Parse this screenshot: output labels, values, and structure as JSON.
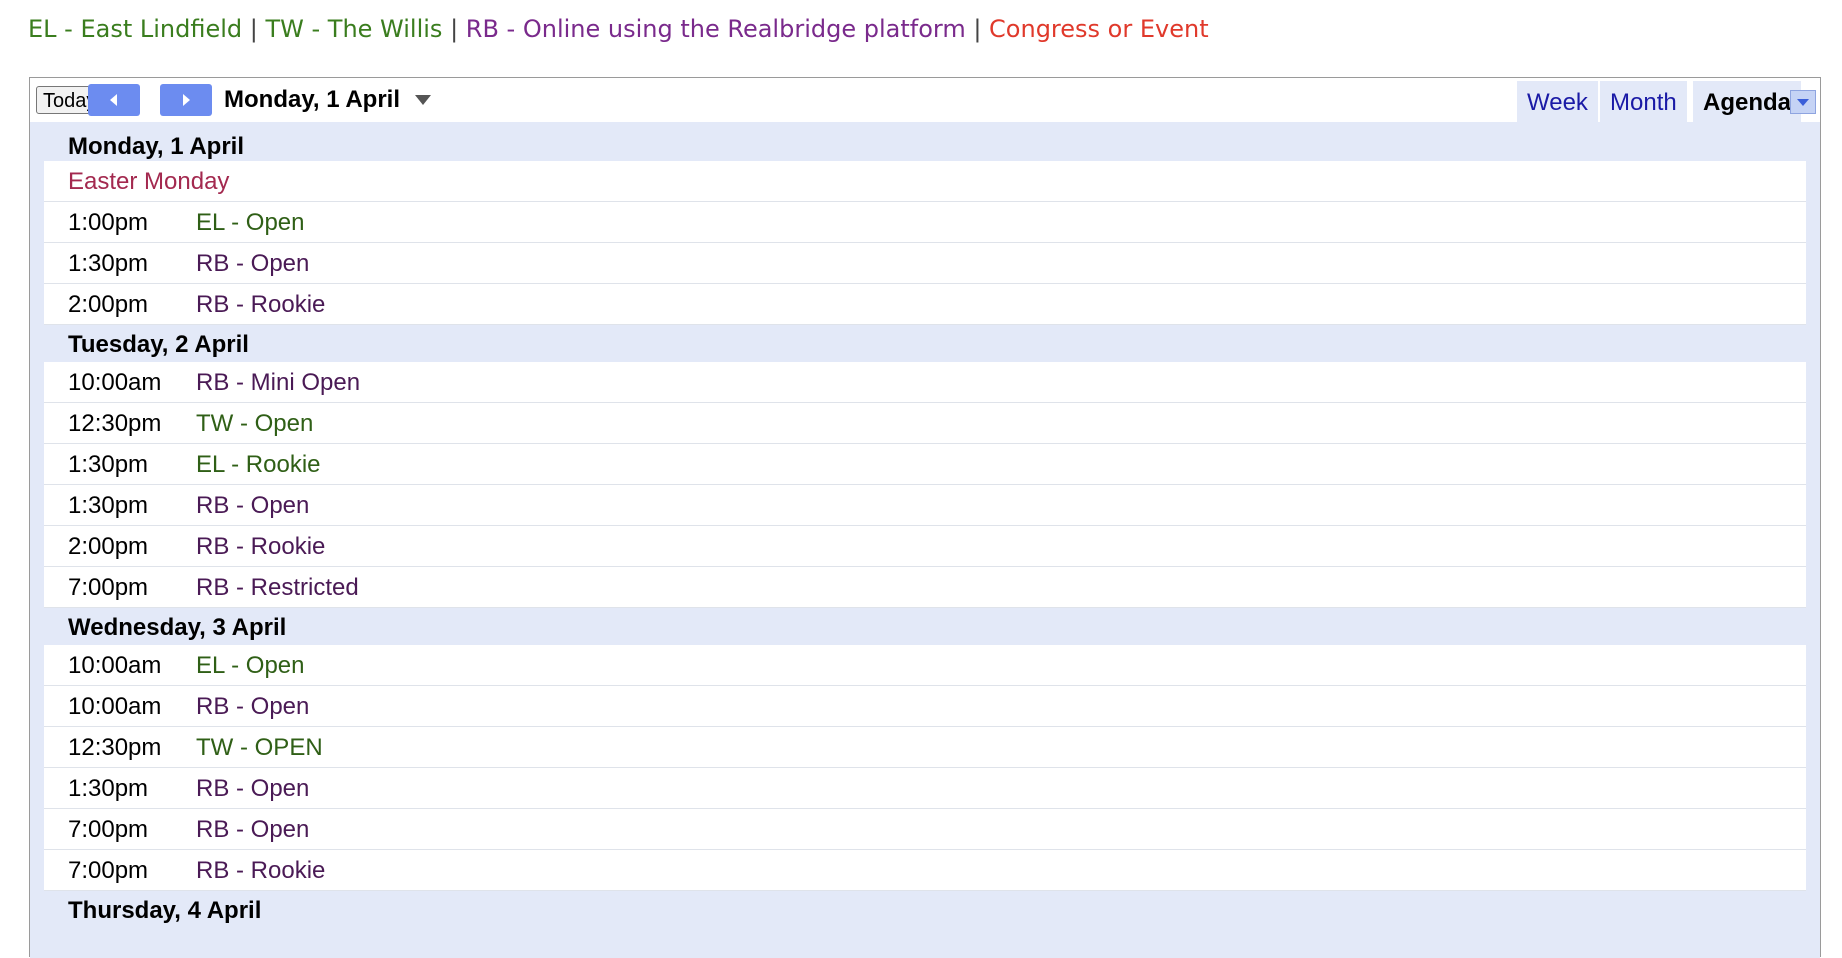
{
  "legend": [
    {
      "text": "EL - East Lindfield",
      "color": "#3a7d1e"
    },
    {
      "text": "TW - The Willis",
      "color": "#3a7d1e"
    },
    {
      "text": "RB - Online using the Realbridge platform",
      "color": "#7a2a8c"
    },
    {
      "text": "Congress or Event",
      "color": "#e0392b"
    }
  ],
  "legend_separator": "|",
  "toolbar": {
    "today_label": "Today",
    "prev_icon": "chevron-left-icon",
    "next_icon": "chevron-right-icon",
    "current_date": "Monday, 1 April",
    "date_dropdown_icon": "caret-down-icon"
  },
  "view_tabs": [
    {
      "label": "Week",
      "active": false
    },
    {
      "label": "Month",
      "active": false
    },
    {
      "label": "Agenda",
      "active": true
    }
  ],
  "colors": {
    "el": "#2f5f16",
    "tw": "#2f5f16",
    "rb": "#4a1a55",
    "holiday": "#a3294f",
    "accent_button": "#6c8cf0",
    "agenda_bg": "#e3e9f8"
  },
  "agenda": {
    "days": [
      {
        "date": "Monday, 1 April",
        "events": [
          {
            "time": "",
            "title": "Easter Monday",
            "kind": "holiday"
          },
          {
            "time": "1:00pm",
            "title": "EL - Open",
            "kind": "el"
          },
          {
            "time": "1:30pm",
            "title": "RB - Open",
            "kind": "rb"
          },
          {
            "time": "2:00pm",
            "title": "RB - Rookie",
            "kind": "rb"
          }
        ]
      },
      {
        "date": "Tuesday, 2 April",
        "events": [
          {
            "time": "10:00am",
            "title": "RB - Mini Open",
            "kind": "rb"
          },
          {
            "time": "12:30pm",
            "title": "TW - Open",
            "kind": "tw"
          },
          {
            "time": "1:30pm",
            "title": "EL - Rookie",
            "kind": "el"
          },
          {
            "time": "1:30pm",
            "title": "RB - Open",
            "kind": "rb"
          },
          {
            "time": "2:00pm",
            "title": "RB - Rookie",
            "kind": "rb"
          },
          {
            "time": "7:00pm",
            "title": "RB - Restricted",
            "kind": "rb"
          }
        ]
      },
      {
        "date": "Wednesday, 3 April",
        "events": [
          {
            "time": "10:00am",
            "title": "EL - Open",
            "kind": "el"
          },
          {
            "time": "10:00am",
            "title": "RB - Open",
            "kind": "rb"
          },
          {
            "time": "12:30pm",
            "title": "TW - OPEN",
            "kind": "tw"
          },
          {
            "time": "1:30pm",
            "title": "RB - Open",
            "kind": "rb"
          },
          {
            "time": "7:00pm",
            "title": "RB - Open",
            "kind": "rb"
          },
          {
            "time": "7:00pm",
            "title": "RB - Rookie",
            "kind": "rb"
          }
        ]
      },
      {
        "date": "Thursday, 4 April",
        "events": []
      }
    ]
  }
}
